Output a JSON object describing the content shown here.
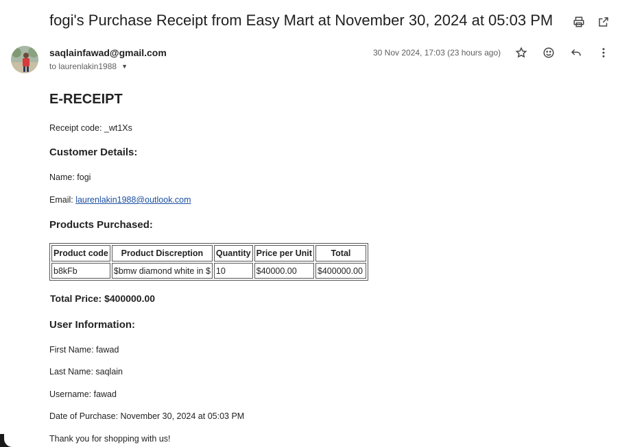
{
  "email": {
    "subject": "fogi's Purchase Receipt from Easy Mart at November 30, 2024 at 05:03 PM",
    "sender": "saqlainfawad@gmail.com",
    "recipient": "to laurenlakin1988",
    "date": "30 Nov 2024, 17:03 (23 hours ago)"
  },
  "icons": {
    "print": "printer-icon",
    "popout": "open-in-new-icon",
    "star": "star-icon",
    "emoji": "emoji-icon",
    "reply": "reply-icon",
    "more": "more-vert-icon",
    "recipient_dropdown": "caret-down-icon"
  },
  "receipt": {
    "title": "E-RECEIPT",
    "receipt_code": "Receipt code: _wt1Xs",
    "customer_heading": "Customer Details:",
    "name_line": "Name: fogi",
    "email_label": "Email: ",
    "email_link": "laurenlakin1988@outlook.com",
    "products_heading": "Products Purchased:",
    "table": {
      "headers": [
        "Product code",
        "Product Discreption",
        "Quantity",
        "Price per Unit",
        "Total"
      ],
      "rows": [
        [
          "b8kFb",
          "$bmw diamond white in $",
          "10",
          "$40000.00",
          "$400000.00"
        ]
      ]
    },
    "total_price": "Total Price: $400000.00",
    "user_heading": "User Information:",
    "first_name": "First Name: fawad",
    "last_name": "Last Name: saqlain",
    "username": "Username: fawad",
    "date_of_purchase": "Date of Purchase: November 30, 2024 at 05:03 PM",
    "thanks": "Thank you for shopping with us!"
  }
}
